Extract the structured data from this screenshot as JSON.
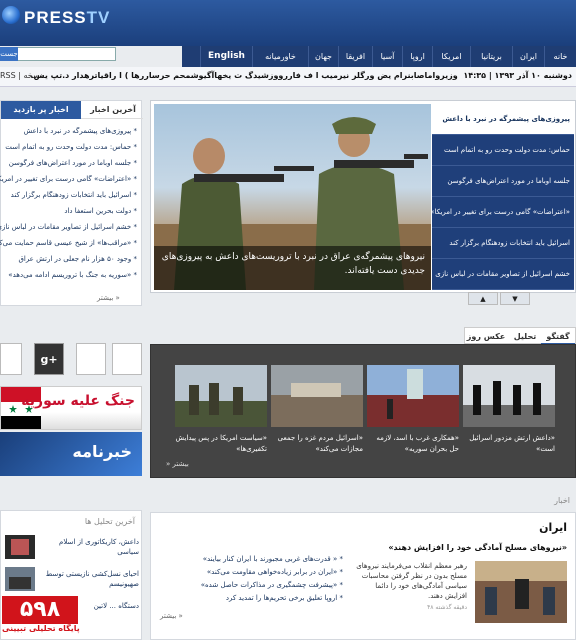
{
  "header": {
    "logo_text": "PRESS",
    "logo_tv": "TV",
    "search_button": "جست"
  },
  "nav": [
    "خانه",
    "ایران",
    "بریتانیا",
    "امریکا",
    "اروپا",
    "آسیا",
    "افریقا",
    "جهان",
    "خاورمیانه",
    "English"
  ],
  "ticker": {
    "rss": "RSS | نسخه",
    "text": "وزیرواماصابنرام یض ورگلر نیرمیب ا ف فاررووزشیدگ ت یخهاآگیوشمحم حرساررها ) ا راقیاترهدار د.تپ یس.",
    "date": "دوشنبه ۱۰ آذر ۱۳۹۳ | ۱۴:۳۵"
  },
  "news_col": {
    "tab_latest": "آخرین اخبار",
    "tab_visited": "اخبار پر بازدید",
    "items": [
      "پیروزی‌های پیشمرگه در نبرد با داعش",
      "حماس: مدت دولت وحدت رو به اتمام است",
      "جلسه اوباما در مورد اعتراض‌های فرگوسن",
      "«اعتراضات» گامی درست برای تغییر در امریکا",
      "اسرائیل باید انتخابات زودهنگام برگزار کند",
      "دولت بحرین استعفا داد",
      "خشم اسرائیل از تصاویر مقامات در لباس نازی",
      "«مراقب‌ها» از شیخ عیسی قاسم حمایت می‌کنند",
      "وجود ۵۰ هزار نام جعلی در ارتش عراق",
      "«سوریه به جنگ با تروریسم ادامه می‌دهد»"
    ],
    "more": "بیشتر »"
  },
  "hero": {
    "caption": "نیروهای پیشمرگه‌ی عراق در نبرد با تروریست‌های داعش به پیروزی‌های جدیدی دست یافته‌اند.",
    "items": [
      "پیروزی‌های پیشمرگه در نبرد با داعش",
      "حماس: مدت دولت وحدت رو به اتمام است",
      "جلسه اوباما در مورد اعتراض‌های فرگوسن",
      "«اعتراضات» گامی درست برای تغییر در امریکا»",
      "اسرائیل باید انتخابات زودهنگام برگزار کند",
      "خشم اسرائیل از تصاویر مقامات در لباس نازی"
    ],
    "up": "▲",
    "down": "▼"
  },
  "social": {
    "gplus": "g+"
  },
  "banners": {
    "syria": "جنگ علیه سوریه",
    "news": "خبرنامه"
  },
  "gallery": {
    "tabs": [
      "گفتگو",
      "تحلیل",
      "عکس روز"
    ],
    "items": [
      "«داعش ارتش مزدور اسرائیل است»",
      "«همکاری غرب با اسد، لازمه حل بحران سوریه»",
      "«اسرائیل مردم غزه را جمعی مجازات می‌کند»",
      "«سیاست امریکا در پس پیدایش تکفیری‌ها»"
    ],
    "more": "بیشتر"
  },
  "lower": {
    "news_label": "اخبار",
    "analysis_title": "آخرین تحلیل ها",
    "analysis_items": [
      "داعش، کاریکاتوری از اسلام سیاسی",
      "احیای نسل‌کشی نازیستی توسط صهیونیسم",
      "دستگاه ... لاتین"
    ],
    "iran_title": "ایران",
    "iran_headline": "«نیروهای مسلح آمادگی خود را افزایش دهند»",
    "iran_summary": "رهبر معظم انقلاب می‌فرمایند نیروهای مسلح بدون در نظر گرفتن محاسبات سیاسی آمادگی‌های خود را دائما افزایش دهند.",
    "iran_time": "۴۸ دقیقه گذشته",
    "iran_links": [
      "« قدرت‌های غربی مجبورند با ایران کنار بیایند»",
      "«ایران در برابر زیاده‌خواهی مقاومت می‌کند»",
      "«پیشرفت چشمگیری در مذاکرات حاصل شده»",
      "اروپا تعلیق برخی تحریم‌ها را تمدید کرد"
    ],
    "iran_more": "بیشتر »"
  },
  "watermark": {
    "num": "۵۹۸",
    "sub": "پایگاه تحلیلی تبیینی"
  }
}
